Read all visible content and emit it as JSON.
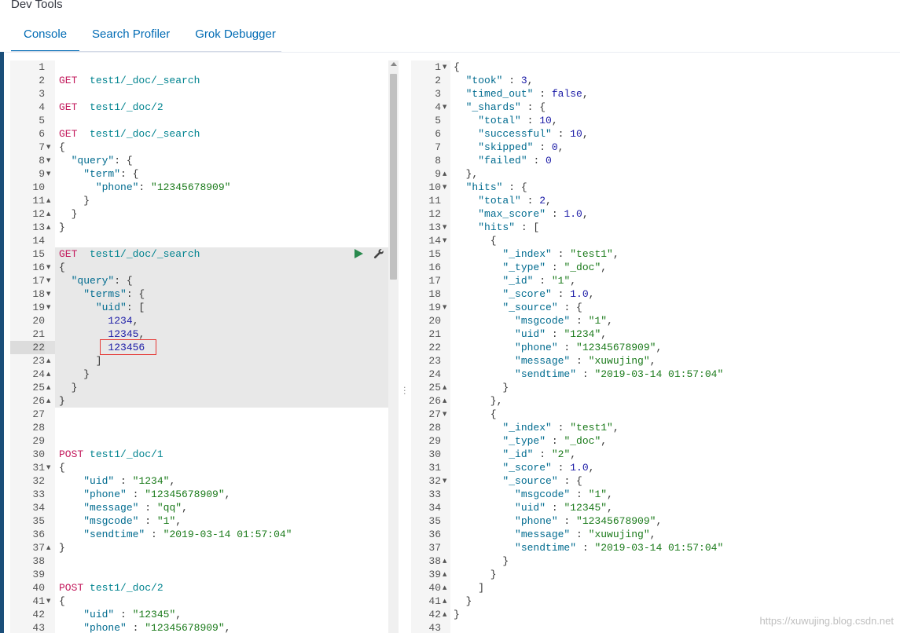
{
  "app": {
    "title": "Dev Tools"
  },
  "tabs": [
    {
      "label": "Console",
      "active": true
    },
    {
      "label": "Search Profiler",
      "active": false
    },
    {
      "label": "Grok Debugger",
      "active": false
    }
  ],
  "colors": {
    "accent": "#006bb4",
    "method": "#c2185b",
    "url": "#00838f",
    "run": "#2a8a4e",
    "highlight": "#e53935"
  },
  "editor": {
    "lines": [
      {
        "n": "1",
        "fold": "",
        "t": ""
      },
      {
        "n": "2",
        "fold": "",
        "t": "GET  test1/_doc/_search"
      },
      {
        "n": "3",
        "fold": "",
        "t": ""
      },
      {
        "n": "4",
        "fold": "",
        "t": "GET  test1/_doc/2"
      },
      {
        "n": "5",
        "fold": "",
        "t": ""
      },
      {
        "n": "6",
        "fold": "",
        "t": "GET  test1/_doc/_search"
      },
      {
        "n": "7",
        "fold": "▼",
        "t": "{"
      },
      {
        "n": "8",
        "fold": "▼",
        "t": "  \"query\": {"
      },
      {
        "n": "9",
        "fold": "▼",
        "t": "    \"term\": {"
      },
      {
        "n": "10",
        "fold": "",
        "t": "      \"phone\": \"12345678909\""
      },
      {
        "n": "11",
        "fold": "▲",
        "t": "    }"
      },
      {
        "n": "12",
        "fold": "▲",
        "t": "  }"
      },
      {
        "n": "13",
        "fold": "▲",
        "t": "}"
      },
      {
        "n": "14",
        "fold": "",
        "t": ""
      },
      {
        "n": "15",
        "fold": "",
        "t": "GET  test1/_doc/_search"
      },
      {
        "n": "16",
        "fold": "▼",
        "t": "{"
      },
      {
        "n": "17",
        "fold": "▼",
        "t": "  \"query\": {"
      },
      {
        "n": "18",
        "fold": "▼",
        "t": "    \"terms\": {"
      },
      {
        "n": "19",
        "fold": "▼",
        "t": "      \"uid\": ["
      },
      {
        "n": "20",
        "fold": "",
        "t": "        1234,"
      },
      {
        "n": "21",
        "fold": "",
        "t": "        12345,"
      },
      {
        "n": "22",
        "fold": "",
        "t": "        123456"
      },
      {
        "n": "23",
        "fold": "▲",
        "t": "      ]"
      },
      {
        "n": "24",
        "fold": "▲",
        "t": "    }"
      },
      {
        "n": "25",
        "fold": "▲",
        "t": "  }"
      },
      {
        "n": "26",
        "fold": "▲",
        "t": "}"
      },
      {
        "n": "27",
        "fold": "",
        "t": ""
      },
      {
        "n": "28",
        "fold": "",
        "t": ""
      },
      {
        "n": "29",
        "fold": "",
        "t": ""
      },
      {
        "n": "30",
        "fold": "",
        "t": "POST test1/_doc/1"
      },
      {
        "n": "31",
        "fold": "▼",
        "t": "{"
      },
      {
        "n": "32",
        "fold": "",
        "t": "    \"uid\" : \"1234\","
      },
      {
        "n": "33",
        "fold": "",
        "t": "    \"phone\" : \"12345678909\","
      },
      {
        "n": "34",
        "fold": "",
        "t": "    \"message\" : \"qq\","
      },
      {
        "n": "35",
        "fold": "",
        "t": "    \"msgcode\" : \"1\","
      },
      {
        "n": "36",
        "fold": "",
        "t": "    \"sendtime\" : \"2019-03-14 01:57:04\""
      },
      {
        "n": "37",
        "fold": "▲",
        "t": "}"
      },
      {
        "n": "38",
        "fold": "",
        "t": ""
      },
      {
        "n": "39",
        "fold": "",
        "t": ""
      },
      {
        "n": "40",
        "fold": "",
        "t": "POST test1/_doc/2"
      },
      {
        "n": "41",
        "fold": "▼",
        "t": "{"
      },
      {
        "n": "42",
        "fold": "",
        "t": "    \"uid\" : \"12345\","
      },
      {
        "n": "43",
        "fold": "",
        "t": "    \"phone\" : \"12345678909\","
      }
    ]
  },
  "output": {
    "lines": [
      {
        "n": "1",
        "fold": "▼",
        "t": "{"
      },
      {
        "n": "2",
        "fold": "",
        "t": "  \"took\" : 3,"
      },
      {
        "n": "3",
        "fold": "",
        "t": "  \"timed_out\" : false,"
      },
      {
        "n": "4",
        "fold": "▼",
        "t": "  \"_shards\" : {"
      },
      {
        "n": "5",
        "fold": "",
        "t": "    \"total\" : 10,"
      },
      {
        "n": "6",
        "fold": "",
        "t": "    \"successful\" : 10,"
      },
      {
        "n": "7",
        "fold": "",
        "t": "    \"skipped\" : 0,"
      },
      {
        "n": "8",
        "fold": "",
        "t": "    \"failed\" : 0"
      },
      {
        "n": "9",
        "fold": "▲",
        "t": "  },"
      },
      {
        "n": "10",
        "fold": "▼",
        "t": "  \"hits\" : {"
      },
      {
        "n": "11",
        "fold": "",
        "t": "    \"total\" : 2,"
      },
      {
        "n": "12",
        "fold": "",
        "t": "    \"max_score\" : 1.0,"
      },
      {
        "n": "13",
        "fold": "▼",
        "t": "    \"hits\" : ["
      },
      {
        "n": "14",
        "fold": "▼",
        "t": "      {"
      },
      {
        "n": "15",
        "fold": "",
        "t": "        \"_index\" : \"test1\","
      },
      {
        "n": "16",
        "fold": "",
        "t": "        \"_type\" : \"_doc\","
      },
      {
        "n": "17",
        "fold": "",
        "t": "        \"_id\" : \"1\","
      },
      {
        "n": "18",
        "fold": "",
        "t": "        \"_score\" : 1.0,"
      },
      {
        "n": "19",
        "fold": "▼",
        "t": "        \"_source\" : {"
      },
      {
        "n": "20",
        "fold": "",
        "t": "          \"msgcode\" : \"1\","
      },
      {
        "n": "21",
        "fold": "",
        "t": "          \"uid\" : \"1234\","
      },
      {
        "n": "22",
        "fold": "",
        "t": "          \"phone\" : \"12345678909\","
      },
      {
        "n": "23",
        "fold": "",
        "t": "          \"message\" : \"xuwujing\","
      },
      {
        "n": "24",
        "fold": "",
        "t": "          \"sendtime\" : \"2019-03-14 01:57:04\""
      },
      {
        "n": "25",
        "fold": "▲",
        "t": "        }"
      },
      {
        "n": "26",
        "fold": "▲",
        "t": "      },"
      },
      {
        "n": "27",
        "fold": "▼",
        "t": "      {"
      },
      {
        "n": "28",
        "fold": "",
        "t": "        \"_index\" : \"test1\","
      },
      {
        "n": "29",
        "fold": "",
        "t": "        \"_type\" : \"_doc\","
      },
      {
        "n": "30",
        "fold": "",
        "t": "        \"_id\" : \"2\","
      },
      {
        "n": "31",
        "fold": "",
        "t": "        \"_score\" : 1.0,"
      },
      {
        "n": "32",
        "fold": "▼",
        "t": "        \"_source\" : {"
      },
      {
        "n": "33",
        "fold": "",
        "t": "          \"msgcode\" : \"1\","
      },
      {
        "n": "34",
        "fold": "",
        "t": "          \"uid\" : \"12345\","
      },
      {
        "n": "35",
        "fold": "",
        "t": "          \"phone\" : \"12345678909\","
      },
      {
        "n": "36",
        "fold": "",
        "t": "          \"message\" : \"xuwujing\","
      },
      {
        "n": "37",
        "fold": "",
        "t": "          \"sendtime\" : \"2019-03-14 01:57:04\""
      },
      {
        "n": "38",
        "fold": "▲",
        "t": "        }"
      },
      {
        "n": "39",
        "fold": "▲",
        "t": "      }"
      },
      {
        "n": "40",
        "fold": "▲",
        "t": "    ]"
      },
      {
        "n": "41",
        "fold": "▲",
        "t": "  }"
      },
      {
        "n": "42",
        "fold": "▲",
        "t": "}"
      },
      {
        "n": "43",
        "fold": "",
        "t": ""
      }
    ]
  },
  "icons": {
    "run": "play-icon",
    "settings": "wrench-icon",
    "resize": "drag-handle-icon"
  },
  "watermark": "https://xuwujing.blog.csdn.net"
}
